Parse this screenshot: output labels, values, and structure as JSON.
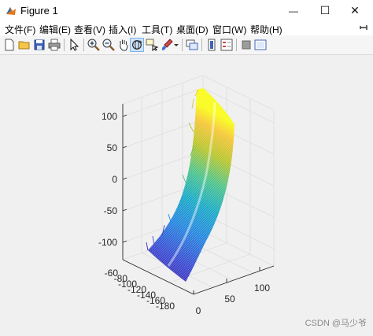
{
  "window": {
    "title": "Figure 1",
    "minimize_glyph": "—",
    "maximize_glyph": "☐",
    "close_glyph": "✕"
  },
  "menubar": {
    "items": [
      "文件(F)",
      "编辑(E)",
      "查看(V)",
      "插入(I)",
      "工具(T)",
      "桌面(D)",
      "窗口(W)",
      "帮助(H)"
    ]
  },
  "toolbar": {
    "icons": [
      "new-figure-icon",
      "open-file-icon",
      "save-icon",
      "print-icon",
      "select-arrow-icon",
      "zoom-in-icon",
      "zoom-out-icon",
      "pan-hand-icon",
      "rotate-3d-icon",
      "data-cursor-icon",
      "brush-icon",
      "brush-dropdown-icon",
      "link-plot-icon",
      "colorbar-icon",
      "legend-icon",
      "hide-plot-tools-icon",
      "show-plot-tools-icon"
    ],
    "active": "rotate-3d-icon"
  },
  "axes": {
    "z_ticks": [
      "100",
      "50",
      "0",
      "-50",
      "-100"
    ],
    "y_ticks": [
      "-60",
      "-80",
      "-100",
      "-120",
      "-140",
      "-160",
      "-180"
    ],
    "x_ticks": [
      "0",
      "50",
      "100"
    ]
  },
  "colors": {
    "colormap": [
      "#3e26a8",
      "#2f6fd8",
      "#1fa8c9",
      "#4cc38a",
      "#b8c52a",
      "#f5d02b",
      "#f9fb15"
    ]
  },
  "watermark": "CSDN @马少爷"
}
